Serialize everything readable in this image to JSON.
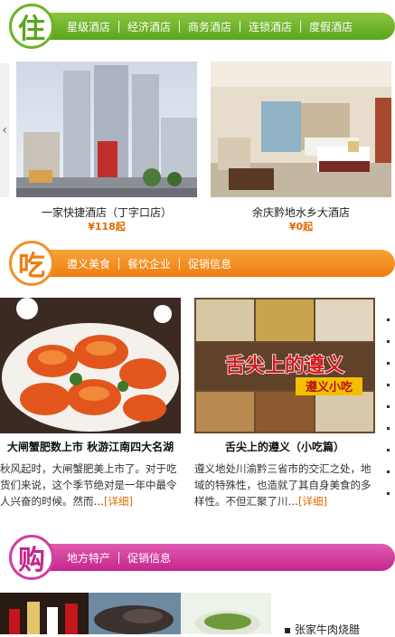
{
  "hotel": {
    "seal_char": "住",
    "nav": [
      "星级酒店",
      "经济酒店",
      "商务酒店",
      "连锁酒店",
      "度假酒店"
    ],
    "prev_arrow": "‹",
    "items": [
      {
        "name": "一家快捷酒店（丁字口店）",
        "price": "¥118起"
      },
      {
        "name": "余庆黔地水乡大酒店",
        "price": "¥0起"
      }
    ]
  },
  "food": {
    "seal_char": "吃",
    "nav": [
      "遵义美食",
      "餐饮企业",
      "促销信息"
    ],
    "articles": [
      {
        "title": "大闸蟹肥数上市 秋游江南四大名湖",
        "excerpt": "秋风起时，大闸蟹肥美上市了。对于吃货们来说，这个季节绝对是一年中最令人兴奋的时候。然而…",
        "more": "[详细]"
      },
      {
        "title": "舌尖上的遵义（小吃篇）",
        "excerpt": "遵义地处川渝黔三省市的交汇之处，地域的特殊性，也造就了其自身美食的多样性。不但汇聚了川…",
        "more": "[详细]",
        "image_text": "舌尖上的遵义",
        "image_subtext": "遵义小吃"
      }
    ]
  },
  "shop": {
    "seal_char": "购",
    "nav": [
      "地方特产",
      "促销信息"
    ],
    "list": [
      "张家牛肉烧腊"
    ]
  }
}
